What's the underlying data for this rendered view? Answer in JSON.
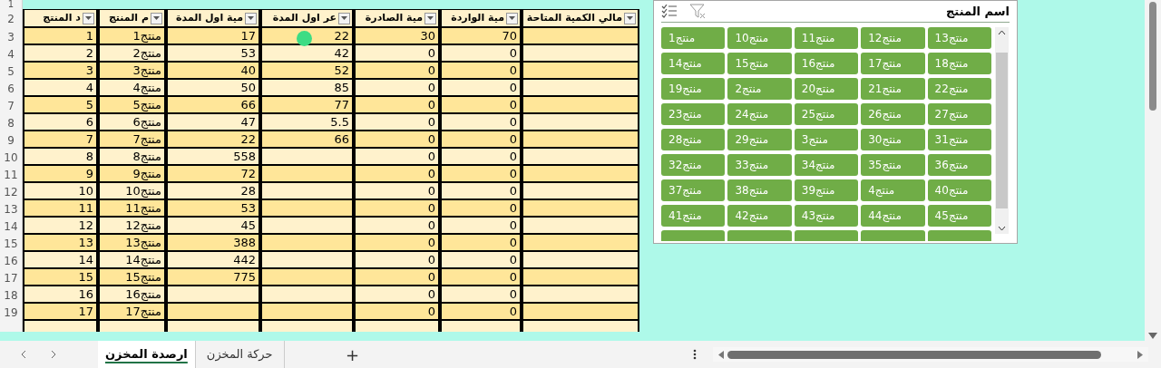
{
  "sheet": {
    "row_numbers": [
      "1",
      "2",
      "3",
      "4",
      "5",
      "6",
      "7",
      "8",
      "9",
      "10",
      "11",
      "12",
      "13",
      "14",
      "15",
      "16",
      "17",
      "18",
      "19"
    ],
    "columns": [
      "مالي الكمية المتاحة",
      "مية الواردة",
      "مية الصادرة",
      "عر اول المدة",
      "مية اول المدة",
      "م المنتج",
      "د المنتج"
    ],
    "rows": [
      [
        "",
        "70",
        "30",
        "22",
        "17",
        "منتج1",
        "1"
      ],
      [
        "",
        "0",
        "0",
        "42",
        "53",
        "منتج2",
        "2"
      ],
      [
        "",
        "0",
        "0",
        "52",
        "40",
        "منتج3",
        "3"
      ],
      [
        "",
        "0",
        "0",
        "85",
        "50",
        "منتج4",
        "4"
      ],
      [
        "",
        "0",
        "0",
        "77",
        "66",
        "منتج5",
        "5"
      ],
      [
        "",
        "0",
        "0",
        "5.5",
        "47",
        "منتج6",
        "6"
      ],
      [
        "",
        "0",
        "0",
        "66",
        "22",
        "منتج7",
        "7"
      ],
      [
        "",
        "0",
        "0",
        "",
        "558",
        "منتج8",
        "8"
      ],
      [
        "",
        "0",
        "0",
        "",
        "72",
        "منتج9",
        "9"
      ],
      [
        "",
        "0",
        "0",
        "",
        "28",
        "منتج10",
        "10"
      ],
      [
        "",
        "0",
        "0",
        "",
        "53",
        "منتج11",
        "11"
      ],
      [
        "",
        "0",
        "0",
        "",
        "45",
        "منتج12",
        "12"
      ],
      [
        "",
        "0",
        "0",
        "",
        "388",
        "منتج13",
        "13"
      ],
      [
        "",
        "0",
        "0",
        "",
        "442",
        "منتج14",
        "14"
      ],
      [
        "",
        "0",
        "0",
        "",
        "775",
        "منتج15",
        "15"
      ],
      [
        "",
        "0",
        "0",
        "",
        "",
        "منتج16",
        "16"
      ],
      [
        "",
        "0",
        "0",
        "",
        "",
        "منتج17",
        "17"
      ]
    ]
  },
  "slicer": {
    "title": "اسم المنتج",
    "items": [
      {
        "label": "منتج13",
        "selected": true
      },
      {
        "label": "منتج12",
        "selected": true
      },
      {
        "label": "منتج11",
        "selected": true
      },
      {
        "label": "منتج10",
        "selected": true
      },
      {
        "label": "منتج1",
        "selected": true
      },
      {
        "label": "منتج18",
        "selected": true
      },
      {
        "label": "منتج17",
        "selected": true
      },
      {
        "label": "منتج16",
        "selected": true
      },
      {
        "label": "منتج15",
        "selected": true
      },
      {
        "label": "منتج14",
        "selected": true
      },
      {
        "label": "منتج22",
        "selected": true
      },
      {
        "label": "منتج21",
        "selected": true
      },
      {
        "label": "منتج20",
        "selected": true
      },
      {
        "label": "منتج2",
        "selected": true
      },
      {
        "label": "منتج19",
        "selected": true
      },
      {
        "label": "منتج27",
        "selected": true
      },
      {
        "label": "منتج26",
        "selected": true
      },
      {
        "label": "منتج25",
        "selected": true
      },
      {
        "label": "منتج24",
        "selected": true
      },
      {
        "label": "منتج23",
        "selected": true
      },
      {
        "label": "منتج31",
        "selected": true
      },
      {
        "label": "منتج30",
        "selected": true
      },
      {
        "label": "منتج3",
        "selected": true
      },
      {
        "label": "منتج29",
        "selected": true
      },
      {
        "label": "منتج28",
        "selected": true
      },
      {
        "label": "منتج36",
        "selected": true
      },
      {
        "label": "منتج35",
        "selected": true
      },
      {
        "label": "منتج34",
        "selected": true
      },
      {
        "label": "منتج33",
        "selected": true
      },
      {
        "label": "منتج32",
        "selected": true
      },
      {
        "label": "منتج40",
        "selected": true
      },
      {
        "label": "منتج4",
        "selected": true
      },
      {
        "label": "منتج39",
        "selected": true
      },
      {
        "label": "منتج38",
        "selected": true
      },
      {
        "label": "منتج37",
        "selected": true
      },
      {
        "label": "منتج45",
        "selected": true
      },
      {
        "label": "منتج44",
        "selected": true
      },
      {
        "label": "منتج43",
        "selected": true
      },
      {
        "label": "منتج42",
        "selected": true
      },
      {
        "label": "منتج41",
        "selected": true
      }
    ]
  },
  "sheet_tabs": [
    {
      "label": "حركة المخزن",
      "selected": false
    },
    {
      "label": "ارصدة المخزن",
      "selected": true
    }
  ],
  "add_sheet": "+"
}
